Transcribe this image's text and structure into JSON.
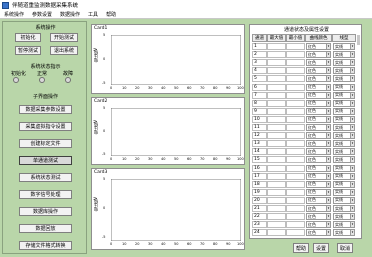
{
  "window": {
    "title": "伴随道重监测数据采集系统"
  },
  "menu": [
    "系统操作",
    "参数设置",
    "数据操作",
    "工具",
    "帮助"
  ],
  "system_ops": {
    "title": "系统操作",
    "buttons": [
      "初始化",
      "开始测试",
      "暂停测试",
      "退出系统"
    ]
  },
  "status": {
    "title": "系统状态指示",
    "labels": [
      "初始化",
      "正常",
      "故障"
    ]
  },
  "sub_ops": {
    "title": "子界面操作",
    "buttons": [
      "数据采集参数设置",
      "采集虚拟指令设置",
      "创建标定文件",
      "单通道测试",
      "系统状态测试",
      "数字信号处理",
      "数据库操作",
      "数据回放",
      "存储文件格式转换"
    ]
  },
  "charts": [
    {
      "title": "Card1",
      "ylabel": "电压值V",
      "yticks": [
        "5",
        "0",
        "-5"
      ],
      "xticks": [
        "0",
        "10",
        "20",
        "30",
        "40",
        "50",
        "60",
        "70",
        "80",
        "90",
        "100"
      ]
    },
    {
      "title": "Card2",
      "ylabel": "电压值V",
      "yticks": [
        "5",
        "0",
        "-5"
      ],
      "xticks": [
        "0",
        "10",
        "20",
        "30",
        "40",
        "50",
        "60",
        "70",
        "80",
        "90",
        "100"
      ]
    },
    {
      "title": "Card3",
      "ylabel": "电压值V",
      "yticks": [
        "5",
        "0",
        "-5"
      ],
      "xticks": [
        "0",
        "10",
        "20",
        "30",
        "40",
        "50",
        "60",
        "70",
        "80",
        "90",
        "100"
      ]
    }
  ],
  "channel_table": {
    "title": "通道状态及属性设置",
    "headers": [
      "通道",
      "最大值",
      "最小值",
      "曲线颜色",
      "线型"
    ],
    "rows": [
      {
        "ch": "1",
        "color": "红色",
        "style": "实线"
      },
      {
        "ch": "2",
        "color": "红色",
        "style": "实线"
      },
      {
        "ch": "3",
        "color": "红色",
        "style": "实线"
      },
      {
        "ch": "4",
        "color": "红色",
        "style": "实线"
      },
      {
        "ch": "5",
        "color": "红色",
        "style": "实线"
      },
      {
        "ch": "6",
        "color": "红色",
        "style": "实线"
      },
      {
        "ch": "7",
        "color": "红色",
        "style": "实线"
      },
      {
        "ch": "8",
        "color": "红色",
        "style": "实线"
      },
      {
        "ch": "9",
        "color": "红色",
        "style": "实线"
      },
      {
        "ch": "10",
        "color": "红色",
        "style": "实线"
      },
      {
        "ch": "11",
        "color": "红色",
        "style": "实线"
      },
      {
        "ch": "12",
        "color": "红色",
        "style": "实线"
      },
      {
        "ch": "13",
        "color": "红色",
        "style": "实线"
      },
      {
        "ch": "14",
        "color": "红色",
        "style": "实线"
      },
      {
        "ch": "15",
        "color": "红色",
        "style": "实线"
      },
      {
        "ch": "16",
        "color": "红色",
        "style": "实线"
      },
      {
        "ch": "17",
        "color": "红色",
        "style": "实线"
      },
      {
        "ch": "18",
        "color": "红色",
        "style": "实线"
      },
      {
        "ch": "19",
        "color": "红色",
        "style": "实线"
      },
      {
        "ch": "20",
        "color": "红色",
        "style": "实线"
      },
      {
        "ch": "21",
        "color": "红色",
        "style": "实线"
      },
      {
        "ch": "22",
        "color": "红色",
        "style": "实线"
      },
      {
        "ch": "23",
        "color": "红色",
        "style": "实线"
      },
      {
        "ch": "24",
        "color": "红色",
        "style": "实线"
      }
    ]
  },
  "footer": {
    "help": "帮助",
    "settings": "设置",
    "cancel": "取消"
  }
}
